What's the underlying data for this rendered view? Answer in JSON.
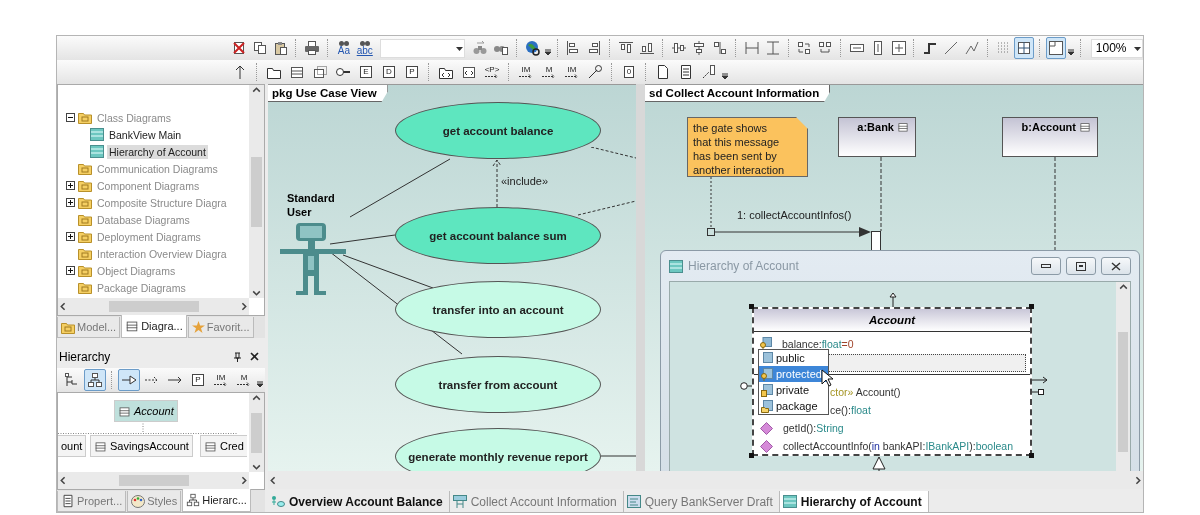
{
  "toolbar_1": [
    {
      "pressed": false
    },
    {
      "pressed": false
    },
    {
      "pressed": false
    },
    {
      "pressed": false
    },
    {
      "glyph": "Aa",
      "pressed": false
    },
    {
      "glyph": "abc",
      "pressed": false
    },
    {
      "pressed": false
    },
    {
      "pressed": false
    },
    {
      "pressed": false
    },
    {
      "pressed": false
    },
    {
      "pressed": false
    },
    {
      "pressed": false
    },
    {
      "pressed": false
    },
    {
      "pressed": false
    },
    {
      "pressed": false
    },
    {
      "pressed": false
    },
    {
      "pressed": false
    },
    {
      "pressed": false
    },
    {
      "pressed": false
    },
    {
      "pressed": false
    },
    {
      "pressed": false
    },
    {
      "pressed": false
    },
    {
      "pressed": false
    },
    {
      "pressed": false
    },
    {
      "pressed": false
    },
    {
      "pressed": false
    },
    {
      "pressed": false
    },
    {
      "pressed": true
    },
    {
      "pressed": true
    }
  ],
  "zoom": {
    "value": "100%"
  },
  "toolbar_2": [
    {
      "pressed": false
    },
    {
      "pressed": false
    },
    {
      "pressed": false
    },
    {
      "pressed": false
    },
    {
      "pressed": false
    },
    {
      "glyph": "E",
      "pressed": false
    },
    {
      "glyph": "D",
      "pressed": false
    },
    {
      "glyph": "P",
      "pressed": false
    },
    {
      "pressed": false
    },
    {
      "pressed": false
    },
    {
      "glyph": "<P>",
      "pressed": false
    },
    {
      "glyph": "IM",
      "pressed": false
    },
    {
      "glyph": "M",
      "pressed": false
    },
    {
      "glyph": "IM",
      "pressed": false
    },
    {
      "pressed": false
    },
    {
      "glyph": "0",
      "pressed": false
    },
    {
      "pressed": false
    },
    {
      "pressed": false
    },
    {
      "pressed": false
    }
  ],
  "model_tree": [
    {
      "label": "Class Diagrams",
      "expandable": true,
      "expanded": true,
      "selected": false,
      "children": [
        {
          "label": "BankView Main",
          "selected": false
        },
        {
          "label": "Hierarchy of Account",
          "selected": true
        }
      ]
    },
    {
      "label": "Communication Diagrams",
      "expandable": false,
      "selected": false
    },
    {
      "label": "Component Diagrams",
      "expandable": true,
      "expanded": false,
      "selected": false
    },
    {
      "label": "Composite Structure Diagra",
      "expandable": true,
      "expanded": false,
      "selected": false
    },
    {
      "label": "Database Diagrams",
      "expandable": false,
      "selected": false
    },
    {
      "label": "Deployment Diagrams",
      "expandable": true,
      "expanded": false,
      "selected": false
    },
    {
      "label": "Interaction Overview Diagra",
      "expandable": false,
      "selected": false
    },
    {
      "label": "Object Diagrams",
      "expandable": true,
      "expanded": false,
      "selected": false
    },
    {
      "label": "Package Diagrams",
      "expandable": false,
      "selected": false
    }
  ],
  "left_tabs": [
    {
      "label": "Model...",
      "selected": false
    },
    {
      "label": "Diagra...",
      "selected": true
    },
    {
      "label": "Favorit...",
      "selected": false
    }
  ],
  "hierarchy_panel": {
    "title": "Hierarchy",
    "toolbar": [
      {
        "pressed": false
      },
      {
        "pressed": true
      },
      {
        "pressed": true
      },
      {
        "pressed": false
      },
      {
        "pressed": false
      },
      {
        "glyph": "P",
        "pressed": false
      },
      {
        "glyph": "IM",
        "pressed": false
      },
      {
        "glyph": "M",
        "pressed": false
      }
    ],
    "root": {
      "label": "Account",
      "selected": true
    },
    "subclasses": [
      {
        "label": "ount",
        "selected": false
      },
      {
        "label": "SavingsAccount",
        "selected": false
      },
      {
        "label": "Cred",
        "selected": false
      }
    ]
  },
  "bottom_left_tabs": [
    {
      "label": "Propert...",
      "selected": false
    },
    {
      "label": "Styles",
      "selected": false
    },
    {
      "label": "Hierarc...",
      "selected": true
    }
  ],
  "use_case_diagram": {
    "title": "pkg Use Case View",
    "actor": "Standard User",
    "include_label": "«include»",
    "use_cases": [
      {
        "label": "get account balance",
        "color": "#5ee6bf"
      },
      {
        "label": "get account balance sum",
        "color": "#5ee6bf"
      },
      {
        "label": "transfer into an account",
        "color": "#c6fae6"
      },
      {
        "label": "transfer from account",
        "color": "#c6fae6"
      },
      {
        "label": "generate monthly revenue report",
        "color": "#c6fae6"
      }
    ]
  },
  "sequence_diagram": {
    "title": "sd Collect Account Information",
    "note_lines": [
      "the gate shows",
      "that this message",
      "has been sent by",
      "another interaction"
    ],
    "lifelines": [
      {
        "label": "a:Bank"
      },
      {
        "label": "b:Account"
      }
    ],
    "message": "1: collectAccountInfos()"
  },
  "class_window": {
    "title": "Hierarchy of Account",
    "class_name": "Account",
    "attributes": [
      {
        "parts": [
          {
            "kind": "name",
            "text": "balance:"
          },
          {
            "kind": "type",
            "text": "float"
          },
          {
            "kind": "value",
            "text": "=0"
          }
        ]
      }
    ],
    "operations": [
      {
        "covered": true,
        "parts": [
          {
            "kind": "stereotype",
            "text": "ctor»"
          },
          {
            "kind": "name",
            "text": " Account()"
          }
        ]
      },
      {
        "covered": true,
        "parts": [
          {
            "kind": "name",
            "text": "ce():"
          },
          {
            "kind": "type",
            "text": "float"
          }
        ]
      },
      {
        "covered": false,
        "parts": [
          {
            "kind": "name",
            "text": "getId():"
          },
          {
            "kind": "type",
            "text": "String"
          }
        ]
      },
      {
        "covered": false,
        "parts": [
          {
            "kind": "name",
            "text": "collectAccountInfo("
          },
          {
            "kind": "keyword",
            "text": "in"
          },
          {
            "kind": "name",
            "text": " bankAPI:"
          },
          {
            "kind": "type",
            "text": "IBankAPI"
          },
          {
            "kind": "name",
            "text": "):"
          },
          {
            "kind": "type",
            "text": "boolean"
          }
        ]
      }
    ],
    "visibility_menu": [
      {
        "label": "public",
        "selected": false
      },
      {
        "label": "protected",
        "selected": true
      },
      {
        "label": "private",
        "selected": false
      },
      {
        "label": "package",
        "selected": false
      }
    ]
  },
  "document_tabs": [
    {
      "label": "Overview Account Balance",
      "bold": true,
      "selected": false
    },
    {
      "label": "Collect Account Information",
      "bold": false,
      "selected": false
    },
    {
      "label": "Query BankServer Draft",
      "bold": false,
      "selected": false
    },
    {
      "label": "Hierarchy of Account",
      "bold": true,
      "selected": true
    }
  ]
}
